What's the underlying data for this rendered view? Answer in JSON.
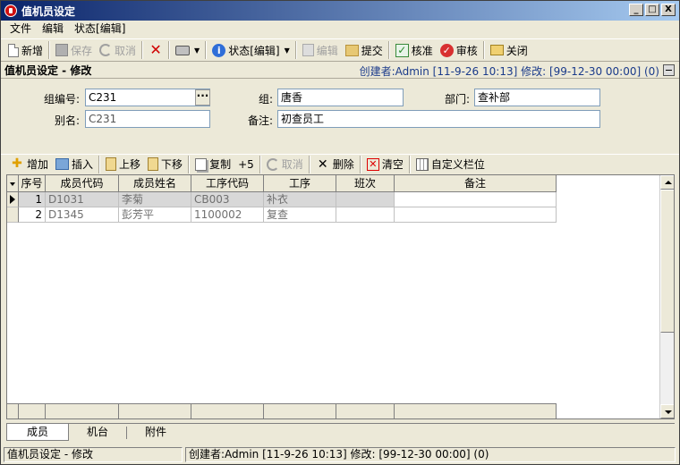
{
  "window": {
    "title": "值机员设定",
    "min": "_",
    "max": "□",
    "close": "X"
  },
  "menu": [
    "文件",
    "编辑",
    "状态[编辑]"
  ],
  "toolbar": {
    "new": "新增",
    "save": "保存",
    "cancel": "取消",
    "status": "状态[编辑]",
    "edit": "编辑",
    "submit": "提交",
    "approve": "核准",
    "audit": "审核",
    "close": "关闭"
  },
  "form": {
    "title": "值机员设定 - 修改",
    "meta": "创建者:Admin [11-9-26 10:13] 修改: [99-12-30 00:00] (0)",
    "group_no_label": "组编号:",
    "group_no": "C231",
    "group_label": "组:",
    "group": "唐香",
    "dept_label": "部门:",
    "dept": "查补部",
    "alias_label": "别名:",
    "alias": "C231",
    "note_label": "备注:",
    "note": "初查员工"
  },
  "subtoolbar": {
    "add": "增加",
    "insert": "插入",
    "move_up": "上移",
    "move_down": "下移",
    "copy": "复制",
    "plus5": "+5",
    "cancel": "取消",
    "delete": "删除",
    "clear": "清空",
    "custom_cols": "自定义栏位"
  },
  "grid": {
    "headers": [
      "序号",
      "成员代码",
      "成员姓名",
      "工序代码",
      "工序",
      "班次",
      "备注"
    ],
    "rows": [
      {
        "seq": "1",
        "member_code": "D1031",
        "member_name": "李菊",
        "process_code": "CB003",
        "process": "补衣",
        "shift": "",
        "note": ""
      },
      {
        "seq": "2",
        "member_code": "D1345",
        "member_name": "彭芳平",
        "process_code": "1100002",
        "process": "复查",
        "shift": "",
        "note": ""
      }
    ]
  },
  "tabs": [
    "成员",
    "机台",
    "附件"
  ],
  "status": {
    "left": "值机员设定 - 修改",
    "right": "创建者:Admin [11-9-26 10:13] 修改: [99-12-30 00:00] (0)"
  },
  "colors": {
    "title_start": "#0a246a",
    "title_end": "#a6caf0",
    "meta": "#1a3a8a",
    "selected_row": "#d8d8d8"
  }
}
